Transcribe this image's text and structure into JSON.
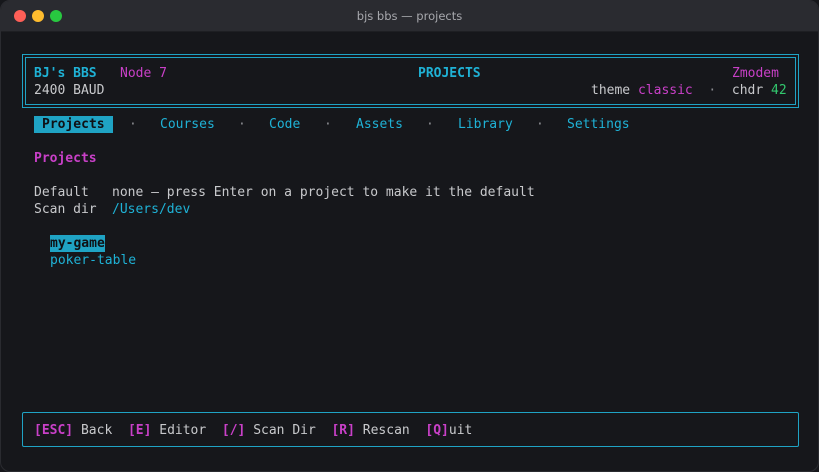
{
  "window": {
    "title": "bjs bbs — projects"
  },
  "header": {
    "bbs_name": "BJ's BBS",
    "node": "Node 7",
    "page_title": "PROJECTS",
    "protocol": "Zmodem",
    "baud": "2400 BAUD",
    "theme_label": "theme",
    "theme_value": "classic",
    "separator": "·",
    "chdr_label": "chdr",
    "chdr_value": "42"
  },
  "tabs": [
    {
      "label": "Projects",
      "active": true
    },
    {
      "label": "Courses",
      "active": false
    },
    {
      "label": "Code",
      "active": false
    },
    {
      "label": "Assets",
      "active": false
    },
    {
      "label": "Library",
      "active": false
    },
    {
      "label": "Settings",
      "active": false
    }
  ],
  "tab_separator": "·",
  "section": {
    "heading": "Projects",
    "default_label": "Default",
    "default_value": "none — press Enter on a project to make it the default",
    "scan_dir_label": "Scan dir",
    "scan_dir_value": "/Users/dev"
  },
  "projects": [
    {
      "name": "my-game",
      "selected": true
    },
    {
      "name": "poker-table",
      "selected": false
    }
  ],
  "footer": {
    "keys": [
      {
        "key": "[ESC]",
        "label": "Back"
      },
      {
        "key": "[E]",
        "label": "Editor"
      },
      {
        "key": "[/]",
        "label": "Scan Dir"
      },
      {
        "key": "[R]",
        "label": "Rescan"
      },
      {
        "key": "[Q]",
        "label": "uit"
      }
    ]
  },
  "colors": {
    "accent": "#1fa3c4",
    "magenta": "#c940c8",
    "green": "#32c86e",
    "background": "#16171b"
  }
}
